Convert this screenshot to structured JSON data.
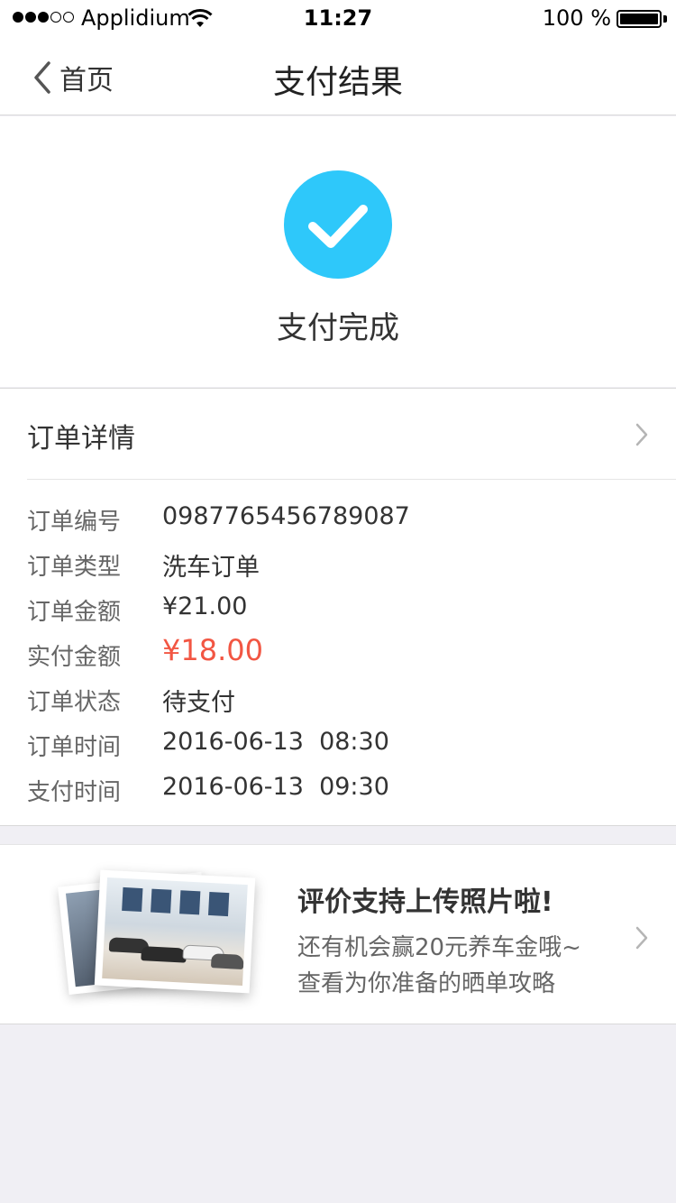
{
  "status_bar": {
    "carrier": "Applidium",
    "time": "11:27",
    "battery": "100 %"
  },
  "nav": {
    "back_label": "首页",
    "title": "支付结果"
  },
  "result": {
    "icon": "check-circle-icon",
    "accent_color": "#2ec8fa",
    "text": "支付完成"
  },
  "order": {
    "header": "订单详情",
    "rows": [
      {
        "label": "订单编号",
        "value": "0987765456789087"
      },
      {
        "label": "订单类型",
        "value": "洗车订单"
      },
      {
        "label": "订单金额",
        "value": "¥21.00"
      },
      {
        "label": "实付金额",
        "value": "¥18.00"
      },
      {
        "label": "订单状态",
        "value": "待支付"
      },
      {
        "label": "订单时间",
        "value": "2016-06-13  08:30"
      },
      {
        "label": "支付时间",
        "value": "2016-06-13  09:30"
      }
    ],
    "highlight_color": "#f25643"
  },
  "promo": {
    "title": "评价支持上传照片啦!",
    "line1": "还有机会赢20元养车金哦~",
    "line2": "查看为你准备的晒单攻略"
  }
}
